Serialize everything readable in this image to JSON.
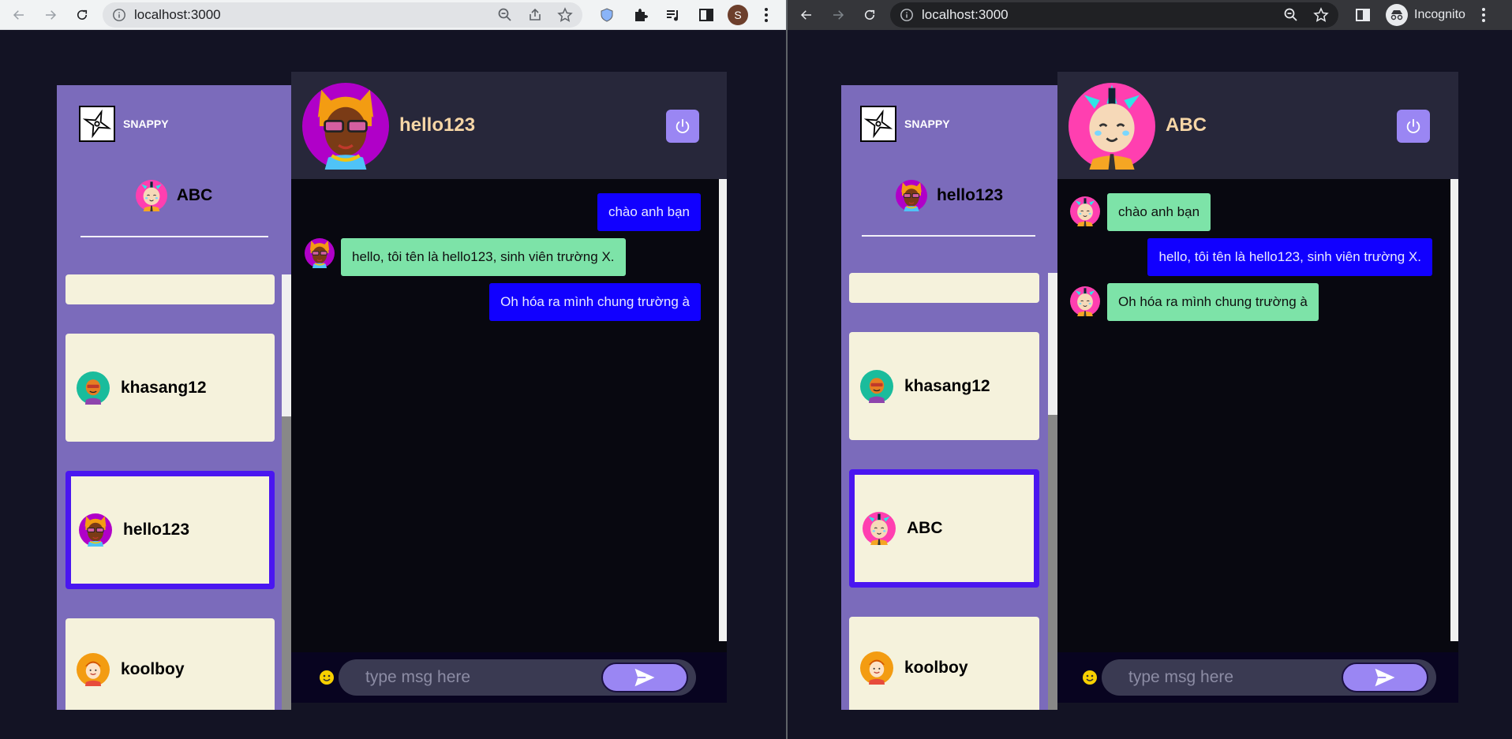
{
  "colors": {
    "page_bg": "#131324",
    "sidebar_bg": "#7b6bbb",
    "card_bg": "#f5f2dc",
    "selected_border": "#4a16f0",
    "sent_bubble": "#1100ff",
    "received_bubble": "#7de3a8",
    "header_name": "#f6d6a6",
    "button_purple": "#9a86f3"
  },
  "left_window": {
    "browser": {
      "url": "localhost:3000",
      "profile_initial": "S"
    },
    "app": {
      "brand": "SNAPPY",
      "current_user": {
        "name": "ABC",
        "avatar": "abc-avatar-icon"
      },
      "contacts": [
        {
          "name": "",
          "avatar": ""
        },
        {
          "name": "khasang12",
          "avatar": "khasang12-avatar-icon"
        },
        {
          "name": "hello123",
          "avatar": "hello123-avatar-icon",
          "selected": true
        },
        {
          "name": "koolboy",
          "avatar": "koolboy-avatar-icon"
        }
      ],
      "chat": {
        "partner": "hello123",
        "messages": [
          {
            "text": "chào anh bạn",
            "direction": "sent"
          },
          {
            "text": "hello, tôi tên là hello123, sinh viên trường X.",
            "direction": "received"
          },
          {
            "text": "Oh hóa ra mình chung trường à",
            "direction": "sent"
          }
        ],
        "input_placeholder": "type msg here"
      }
    }
  },
  "right_window": {
    "browser": {
      "url": "localhost:3000",
      "incognito_label": "Incognito"
    },
    "app": {
      "brand": "SNAPPY",
      "current_user": {
        "name": "hello123",
        "avatar": "hello123-avatar-icon"
      },
      "contacts": [
        {
          "name": "",
          "avatar": ""
        },
        {
          "name": "khasang12",
          "avatar": "khasang12-avatar-icon"
        },
        {
          "name": "ABC",
          "avatar": "abc-avatar-icon",
          "selected": true
        },
        {
          "name": "koolboy",
          "avatar": "koolboy-avatar-icon"
        }
      ],
      "chat": {
        "partner": "ABC",
        "messages": [
          {
            "text": "chào anh bạn",
            "direction": "received"
          },
          {
            "text": "hello, tôi tên là hello123, sinh viên trường X.",
            "direction": "sent"
          },
          {
            "text": "Oh hóa ra mình chung trường à",
            "direction": "received"
          }
        ],
        "input_placeholder": "type msg here"
      }
    }
  }
}
